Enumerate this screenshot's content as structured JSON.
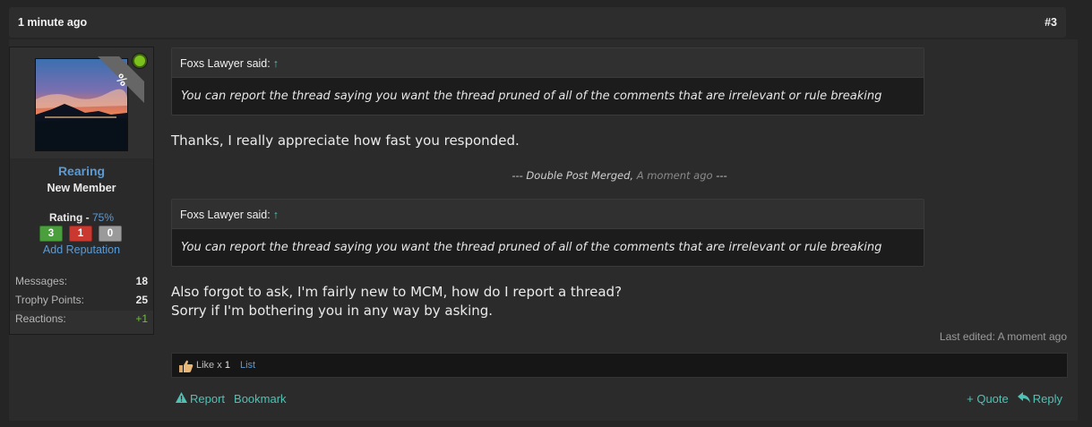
{
  "post_header": {
    "time": "1 minute ago",
    "number": "#3"
  },
  "user": {
    "name": "Rearing",
    "title": "New Member",
    "rating_label": "Rating -",
    "rating_pct": "75%",
    "rep_positive": "3",
    "rep_negative": "1",
    "rep_neutral": "0",
    "add_reputation": "Add Reputation",
    "online": true,
    "ribbon_text": "%"
  },
  "stats": [
    {
      "label": "Messages:",
      "value": "18"
    },
    {
      "label": "Trophy Points:",
      "value": "25"
    },
    {
      "label": "Reactions:",
      "value": "+1"
    }
  ],
  "quotes": [
    {
      "author": "Foxs Lawyer said:",
      "arrow": "↑",
      "text": "You can report the thread saying you want the thread pruned of all of the comments that are irrelevant or rule breaking"
    },
    {
      "author": "Foxs Lawyer said:",
      "arrow": "↑",
      "text": "You can report the thread saying you want the thread pruned of all of the comments that are irrelevant or rule breaking"
    }
  ],
  "messages": {
    "first": "Thanks, I really appreciate how fast you responded.",
    "merged_label": "--- Double Post Merged,",
    "merged_time": "A moment ago",
    "merged_end": "---",
    "second_line1": "Also forgot to ask, I'm fairly new to MCM, how do I report a thread?",
    "second_line2": "Sorry if I'm bothering you in any way by asking."
  },
  "last_edited": "Last edited: A moment ago",
  "likes": {
    "text": "Like x",
    "count": "1",
    "list": "List"
  },
  "actions": {
    "report": "Report",
    "bookmark": "Bookmark",
    "quote": "+ Quote",
    "reply": "Reply"
  },
  "colors": {
    "accent": "#4fc2b4",
    "link": "#5b9bd5",
    "online": "#7cc21d"
  }
}
